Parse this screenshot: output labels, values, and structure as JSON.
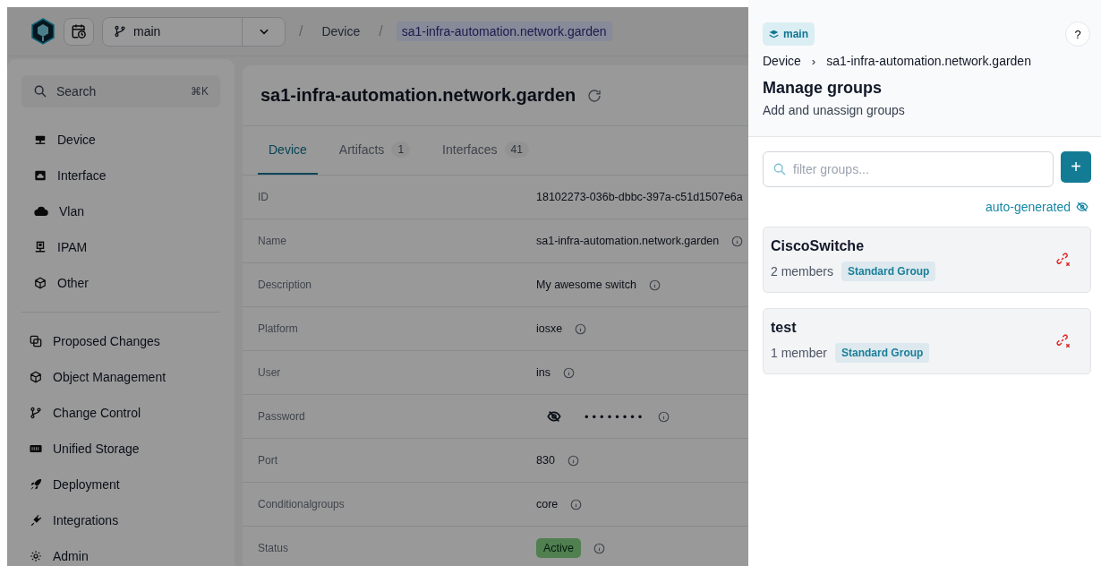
{
  "header": {
    "branch": "main",
    "breadcrumbs": [
      {
        "separator": "/",
        "label": "Device",
        "current": false
      },
      {
        "separator": "/",
        "label": "sa1-infra-automation.network.garden",
        "current": true
      }
    ]
  },
  "sidebar": {
    "search": {
      "placeholder": "Search",
      "shortcut": "⌘K"
    },
    "sections": [
      {
        "items": [
          "Device",
          "Interface",
          "Vlan",
          "IPAM",
          "Other"
        ]
      },
      {
        "items": [
          "Proposed Changes",
          "Object Management",
          "Change Control",
          "Unified Storage",
          "Deployment",
          "Integrations",
          "Admin"
        ]
      }
    ]
  },
  "device": {
    "title": "sa1-infra-automation.network.garden",
    "tabs": [
      {
        "label": "Device",
        "selected": true
      },
      {
        "label": "Artifacts",
        "count": "1",
        "selected": false
      },
      {
        "label": "Interfaces",
        "count": "41",
        "selected": false
      }
    ],
    "rows": [
      {
        "label": "ID",
        "kind": "text",
        "value": "18102273-036b-dbbc-397a-c51d1507e6a",
        "info": false
      },
      {
        "label": "Name",
        "kind": "text",
        "value": "sa1-infra-automation.network.garden",
        "info": true
      },
      {
        "label": "Description",
        "kind": "text",
        "value": "My awesome switch",
        "info": true
      },
      {
        "label": "Platform",
        "kind": "text",
        "value": "iosxe",
        "info": true
      },
      {
        "label": "User",
        "kind": "text",
        "value": "ins",
        "info": true
      },
      {
        "label": "Password",
        "kind": "password",
        "value": "••••••••",
        "info": true
      },
      {
        "label": "Port",
        "kind": "text",
        "value": "830",
        "info": true
      },
      {
        "label": "Conditionalgroups",
        "kind": "text",
        "value": "core",
        "info": true
      },
      {
        "label": "Status",
        "kind": "badge",
        "value": "Active",
        "info": true
      }
    ]
  },
  "drawer": {
    "branch": "main",
    "help": "?",
    "breadcrumbs": [
      {
        "label": "Device"
      },
      {
        "separator": "›",
        "label": "sa1-infra-automation.network.garden"
      }
    ],
    "title": "Manage groups",
    "subtitle": "Add and unassign groups",
    "filter": {
      "placeholder": "filter groups..."
    },
    "add_button": "+",
    "toggle": "auto-generated",
    "groups": [
      {
        "name": "CiscoSwitche",
        "members": "2 members",
        "type": "Standard Group"
      },
      {
        "name": "test",
        "members": "1 member",
        "type": "Standard Group"
      }
    ]
  }
}
